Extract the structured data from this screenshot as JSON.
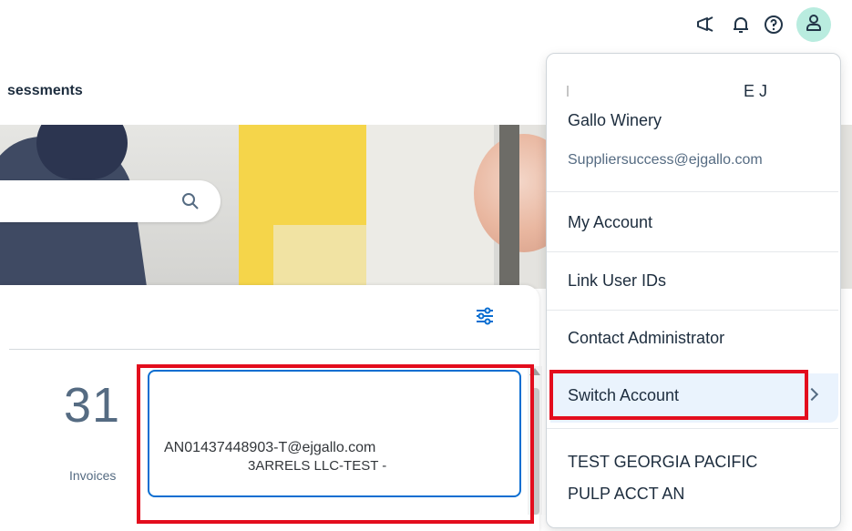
{
  "header": {
    "icons": [
      "megaphone-icon",
      "bell-icon",
      "help-icon",
      "user-icon"
    ]
  },
  "nav": {
    "tab_label": "sessments"
  },
  "card": {
    "big_number": "31",
    "label": "Invoices"
  },
  "account_list": {
    "line1": "AN01437448903-T@ejgallo.com",
    "line2": "3ARRELS LLC-TEST -"
  },
  "user_menu": {
    "name_tail": "E J",
    "company": "Gallo Winery",
    "email": "Suppliersuccess@ejgallo.com",
    "items": [
      "My Account",
      "Link User IDs",
      "Contact Administrator",
      "Switch Account"
    ],
    "submenu_account_line1": "TEST GEORGIA PACIFIC",
    "submenu_account_line2": "PULP ACCT AN"
  },
  "colors": {
    "highlight": "#e30d1d",
    "avatar_bg": "#b9ecdf",
    "focus_border": "#0a6ed1"
  }
}
